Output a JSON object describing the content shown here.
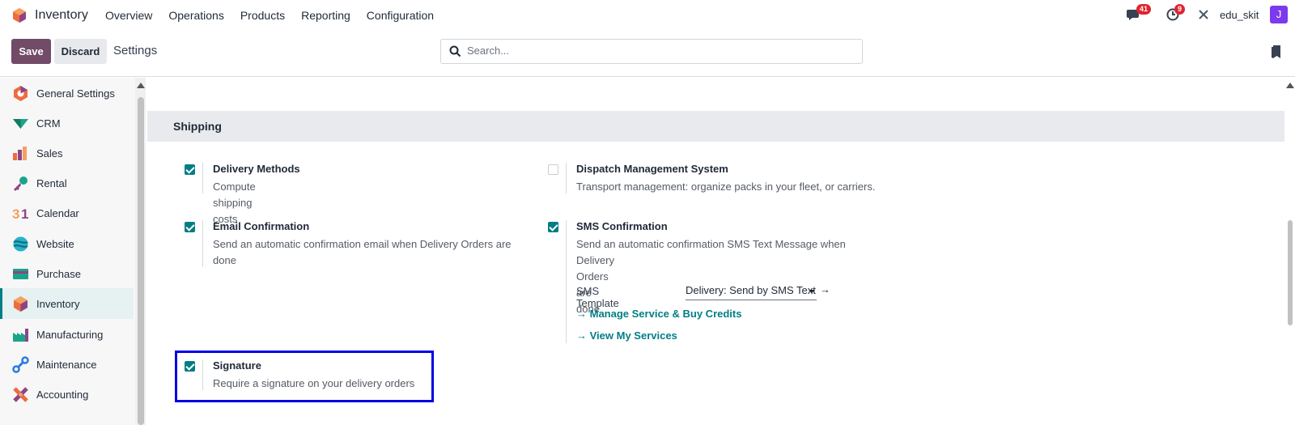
{
  "navbar": {
    "app_name": "Inventory",
    "menu": [
      "Overview",
      "Operations",
      "Products",
      "Reporting",
      "Configuration"
    ],
    "messages_count": "41",
    "activities_count": "9",
    "username": "edu_skit",
    "avatar_letter": "J"
  },
  "control_panel": {
    "save_label": "Save",
    "discard_label": "Discard",
    "title": "Settings",
    "search_placeholder": "Search..."
  },
  "sidebar": {
    "items": [
      {
        "label": "General Settings",
        "icon": "general-settings-icon"
      },
      {
        "label": "CRM",
        "icon": "crm-icon"
      },
      {
        "label": "Sales",
        "icon": "sales-icon"
      },
      {
        "label": "Rental",
        "icon": "rental-icon"
      },
      {
        "label": "Calendar",
        "icon": "calendar-icon"
      },
      {
        "label": "Website",
        "icon": "website-icon"
      },
      {
        "label": "Purchase",
        "icon": "purchase-icon"
      },
      {
        "label": "Inventory",
        "icon": "inventory-icon",
        "active": true
      },
      {
        "label": "Manufacturing",
        "icon": "manufacturing-icon"
      },
      {
        "label": "Maintenance",
        "icon": "maintenance-icon"
      },
      {
        "label": "Accounting",
        "icon": "accounting-icon"
      }
    ]
  },
  "shipping": {
    "heading": "Shipping",
    "delivery_methods": {
      "title": "Delivery Methods",
      "desc": "Compute shipping costs",
      "checked": true
    },
    "dispatch": {
      "title": "Dispatch Management System",
      "desc": "Transport management: organize packs in your fleet, or carriers.",
      "checked": false
    },
    "email": {
      "title": "Email Confirmation",
      "desc_1": "Send an automatic confirmation email when Delivery Orders are",
      "desc_2": "done",
      "checked": true
    },
    "sms": {
      "title": "SMS Confirmation",
      "desc_1": "Send an automatic confirmation SMS Text Message when",
      "desc_2": "Delivery Orders are done",
      "checked": true,
      "template_label": "SMS Template",
      "template_value": "Delivery: Send by SMS Text Message",
      "manage_link": "Manage Service & Buy Credits",
      "services_link": "View My Services"
    },
    "signature": {
      "title": "Signature",
      "desc": "Require a signature on your delivery orders",
      "checked": true
    }
  },
  "colors": {
    "brand": "#714b67",
    "accent": "#017e84",
    "highlight": "#0000e6"
  }
}
